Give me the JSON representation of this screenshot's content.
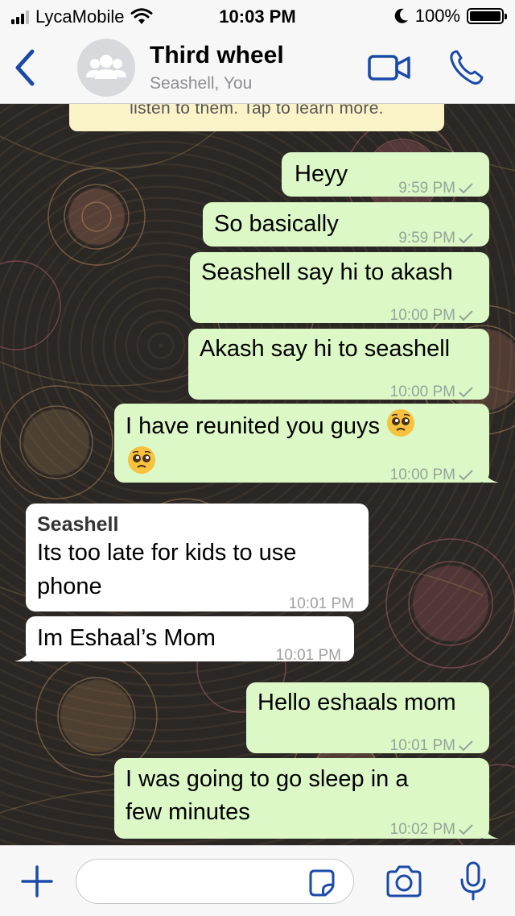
{
  "status_bar": {
    "carrier": "LycaMobile",
    "time": "10:03 PM",
    "battery": "100%",
    "battery_level": 1.0
  },
  "header": {
    "title": "Third wheel",
    "subtitle": "Seashell, You"
  },
  "notice": {
    "text": "listen to them. Tap to learn more."
  },
  "messages": [
    {
      "direction": "out",
      "text": "Heyy",
      "time": "9:59 PM"
    },
    {
      "direction": "out",
      "text": "So basically",
      "time": "9:59 PM"
    },
    {
      "direction": "out",
      "text": "Seashell say hi to akash",
      "time": "10:00 PM"
    },
    {
      "direction": "out",
      "text": "Akash say hi to seashell",
      "time": "10:00 PM"
    },
    {
      "direction": "out",
      "text": "I have reunited you guys",
      "time": "10:00 PM"
    },
    {
      "direction": "in",
      "sender": "Seashell",
      "line1": "Its too late for kids to use",
      "line2": "phone",
      "time": "10:01 PM"
    },
    {
      "direction": "in",
      "text": "Im Eshaal’s Mom",
      "time": "10:01 PM"
    },
    {
      "direction": "out",
      "text": "Hello eshaals mom",
      "time": "10:01 PM"
    },
    {
      "direction": "out",
      "line1": "I was going to go sleep in a",
      "line2": "few minutes",
      "time": "10:02 PM"
    }
  ],
  "input": {
    "placeholder": ""
  },
  "colors": {
    "accent": "#1a4aa8",
    "outgoing_bubble": "#dcf8c6",
    "incoming_bubble": "#ffffff",
    "notice_bg": "#fbf3c8"
  },
  "icons": [
    "back-chevron-icon",
    "group-avatar-icon",
    "video-call-icon",
    "phone-icon",
    "plus-icon",
    "sticker-icon",
    "camera-icon",
    "microphone-icon",
    "read-check-icon",
    "pleading-face-emoji"
  ]
}
